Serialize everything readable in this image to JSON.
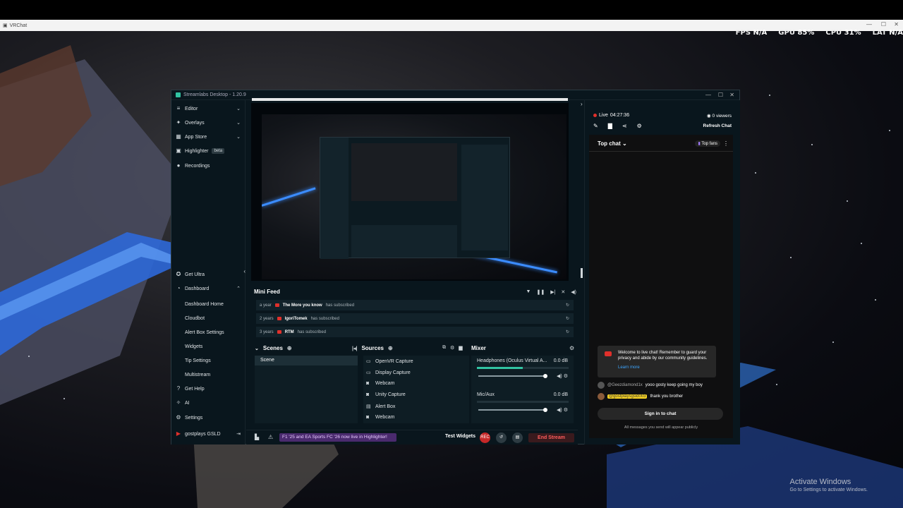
{
  "vrchat": {
    "title": "VRChat",
    "hud": [
      {
        "label": "FPS",
        "value": "N/A"
      },
      {
        "label": "GPU",
        "value": "85%"
      },
      {
        "label": "CPU",
        "value": "31%"
      },
      {
        "label": "LAT",
        "value": "N/A"
      }
    ]
  },
  "streamlabs": {
    "title": "Streamlabs Desktop - 1.20.9",
    "sidebar": {
      "top_items": [
        {
          "label": "Editor",
          "icon": "sliders-icon"
        },
        {
          "label": "Overlays",
          "icon": "magic-icon"
        },
        {
          "label": "App Store",
          "icon": "store-icon"
        },
        {
          "label": "Highlighter",
          "icon": "highlighter-icon",
          "badge": "beta"
        },
        {
          "label": "Recordings",
          "icon": "recordings-icon"
        }
      ],
      "get_ultra": "Get Ultra",
      "dashboard": "Dashboard",
      "dashboard_subitems": [
        "Dashboard Home",
        "Cloudbot",
        "Alert Box Settings",
        "Widgets",
        "Tip Settings",
        "Multistream"
      ],
      "get_help": "Get Help",
      "ai": "AI",
      "settings": "Settings",
      "account": "gostplays GSLD"
    },
    "minifeed": {
      "title": "Mini Feed",
      "rows": [
        {
          "time": "a year",
          "name": "The More you know",
          "action": "has subscribed"
        },
        {
          "time": "2 years",
          "name": "IgoriTomek",
          "action": "has subscribed"
        },
        {
          "time": "3 years",
          "name": "RTM",
          "action": "has subscribed"
        }
      ]
    },
    "scenes": {
      "title": "Scenes",
      "items": [
        "Scene"
      ]
    },
    "sources": {
      "title": "Sources",
      "items": [
        {
          "label": "OpenVR Capture",
          "icon": "monitor-icon"
        },
        {
          "label": "Display Capture",
          "icon": "monitor-icon"
        },
        {
          "label": "Webcam",
          "icon": "webcam-icon"
        },
        {
          "label": "Unity Capture",
          "icon": "webcam-icon"
        },
        {
          "label": "Alert Box",
          "icon": "alert-box-icon"
        },
        {
          "label": "Webcam",
          "icon": "webcam-icon"
        }
      ]
    },
    "mixer": {
      "title": "Mixer",
      "channels": [
        {
          "name": "Headphones (Oculus Virtual A...",
          "db": "0.0 dB"
        },
        {
          "name": "Mic/Aux",
          "db": "0.0 dB"
        }
      ]
    },
    "bottombar": {
      "promo": "F1 '25 and EA Sports FC '26 now live in Highlighter!",
      "test_widgets": "Test Widgets",
      "rec_label": "REC",
      "end_stream": "End Stream"
    },
    "chat": {
      "live_label": "Live",
      "live_time": "04:27:36",
      "viewers": "0 viewers",
      "refresh": "Refresh Chat",
      "top_chat": "Top chat",
      "top_fans": "Top fans",
      "notice": "Welcome to live chat! Remember to guard your privacy and abide by our community guidelines.",
      "learn_more": "Learn more",
      "messages": [
        {
          "author": "@Geezdiamond1x",
          "text": "yooo gosty keep going my boy",
          "highlight": false
        },
        {
          "author": "@gostplaysgsld003",
          "text": "thank you brother",
          "highlight": true
        }
      ],
      "sign_in": "Sign in to chat",
      "public_note": "All messages you send will appear publicly"
    }
  },
  "windows_activation": {
    "line1": "Activate Windows",
    "line2": "Go to Settings to activate Windows."
  },
  "colors": {
    "accent": "#31c3a2",
    "live_red": "#e0302b",
    "promo_purple": "#4a2a6e"
  }
}
